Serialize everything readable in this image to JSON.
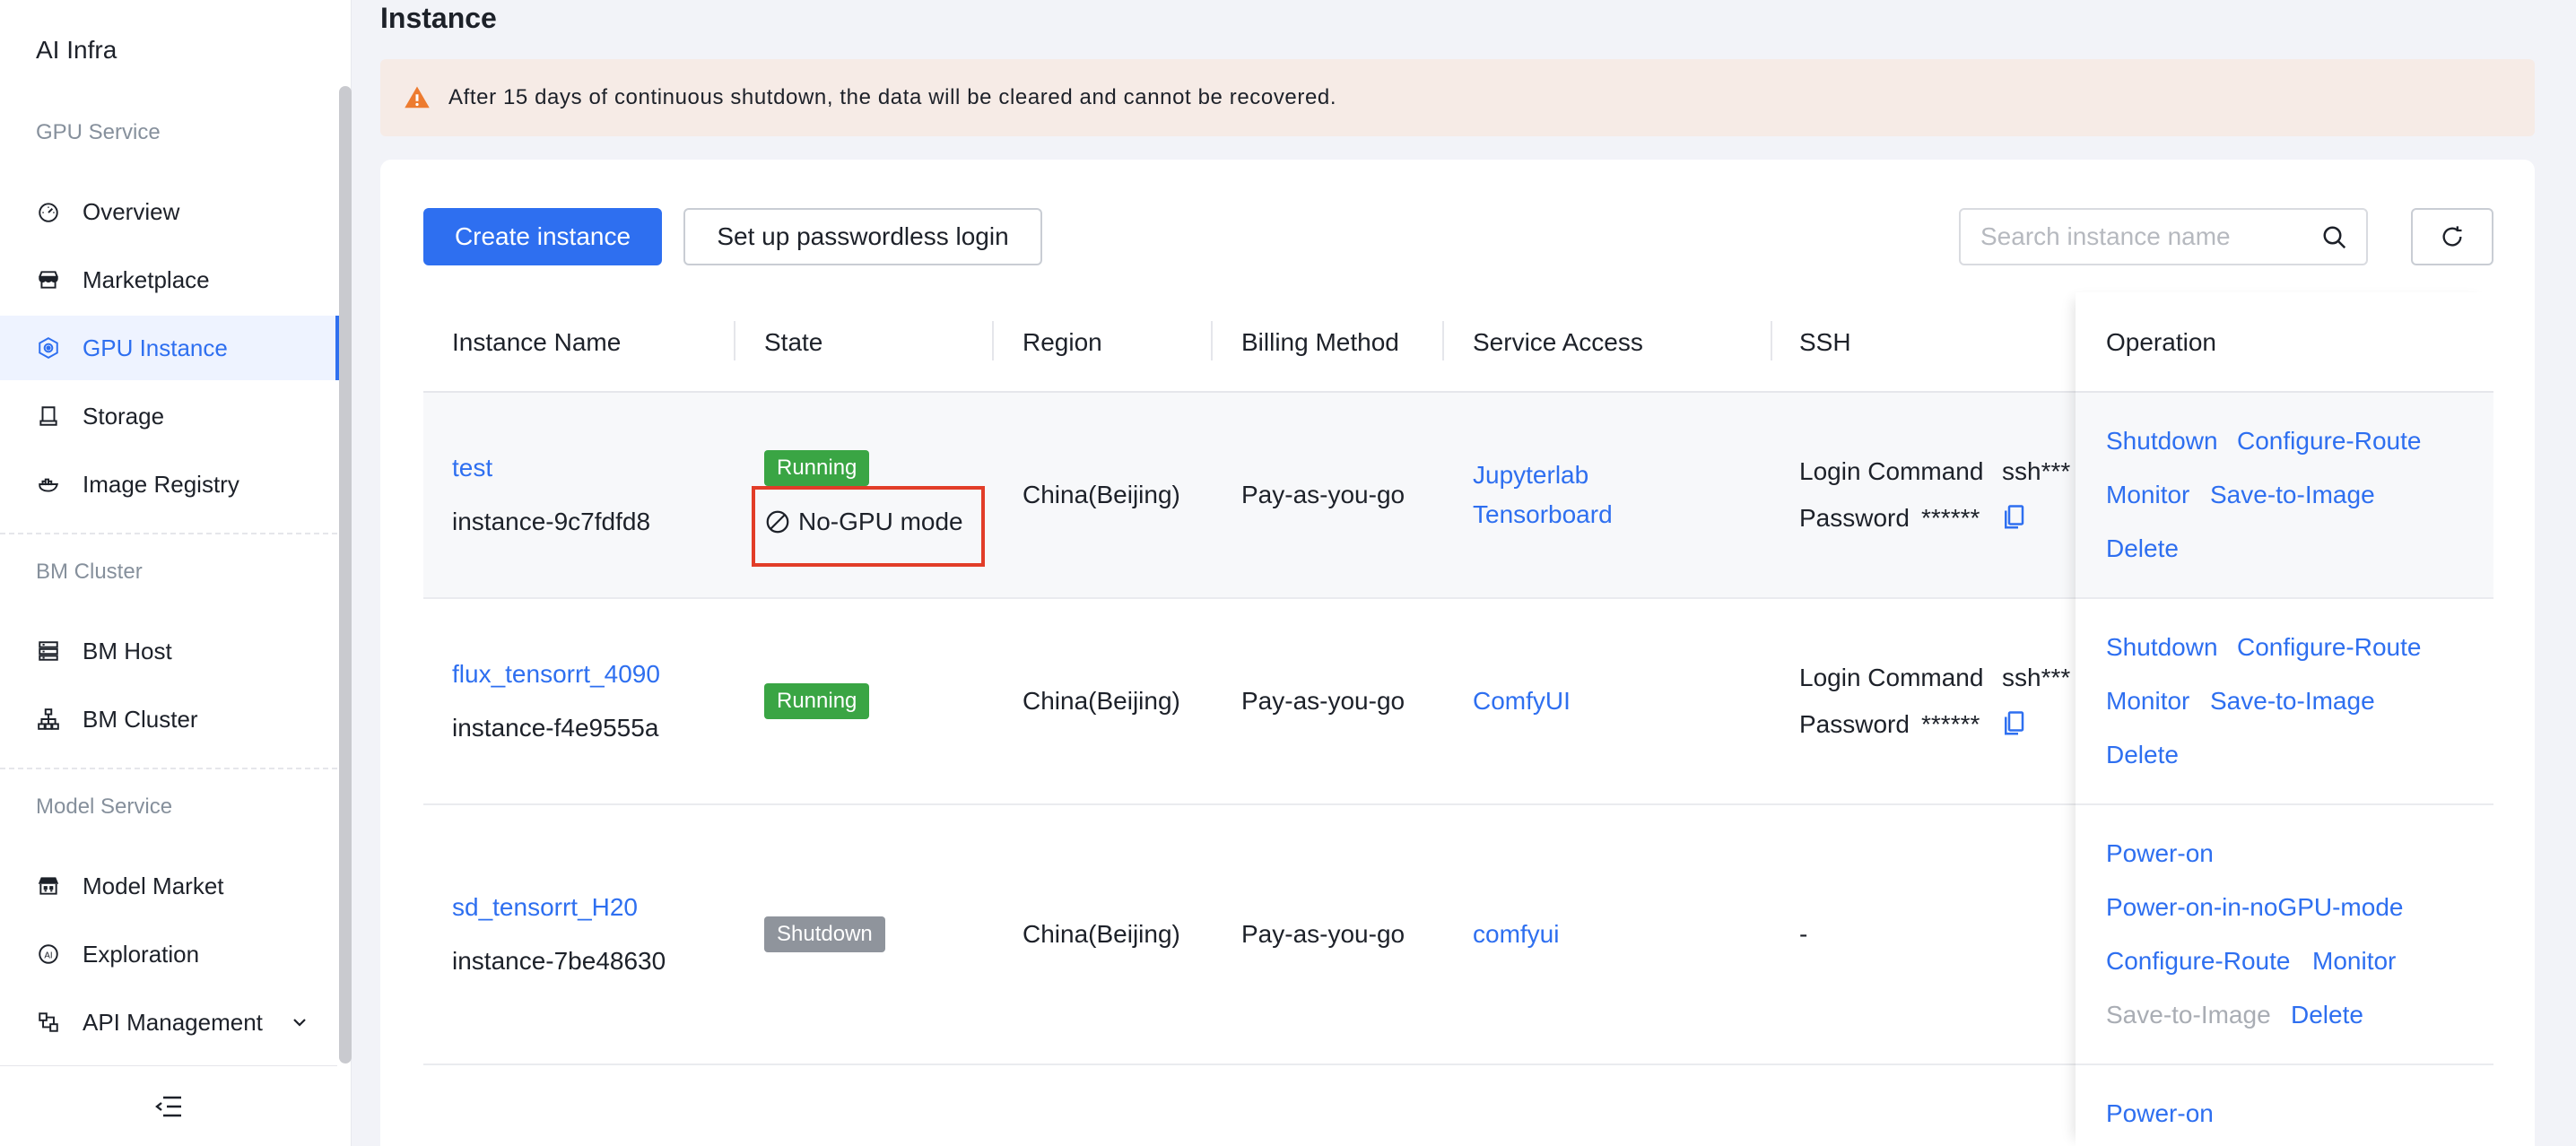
{
  "app": {
    "title": "AI Infra"
  },
  "sidebar": {
    "sections": [
      {
        "title": "GPU Service",
        "items": [
          {
            "label": "Overview",
            "icon": "dashboard-icon"
          },
          {
            "label": "Marketplace",
            "icon": "store-icon"
          },
          {
            "label": "GPU Instance",
            "icon": "chip-icon",
            "active": true
          },
          {
            "label": "Storage",
            "icon": "storage-icon"
          },
          {
            "label": "Image Registry",
            "icon": "container-icon"
          }
        ]
      },
      {
        "title": "BM Cluster",
        "items": [
          {
            "label": "BM Host",
            "icon": "server-icon"
          },
          {
            "label": "BM Cluster",
            "icon": "cluster-icon"
          }
        ]
      },
      {
        "title": "Model Service",
        "items": [
          {
            "label": "Model Market",
            "icon": "grid-store-icon"
          },
          {
            "label": "Exploration",
            "icon": "ai-icon"
          },
          {
            "label": "API Management",
            "icon": "api-icon"
          }
        ]
      }
    ]
  },
  "page": {
    "title": "Instance"
  },
  "alert": {
    "text": "After 15 days of continuous shutdown, the data will be cleared and cannot be recovered."
  },
  "toolbar": {
    "create_label": "Create instance",
    "passwordless_label": "Set up passwordless login",
    "search_placeholder": "Search instance name"
  },
  "table": {
    "columns": [
      "Instance Name",
      "State",
      "Region",
      "Billing Method",
      "Service Access",
      "SSH",
      "Operation"
    ],
    "ssh_login_label": "Login Command",
    "ssh_login_value": "ssh***",
    "ssh_password_label": "Password",
    "ssh_password_value": "******",
    "rows": [
      {
        "name": "test",
        "id": "instance-9c7fdfd8",
        "state": "Running",
        "mode": "No-GPU mode",
        "region": "China(Beijing)",
        "billing": "Pay-as-you-go",
        "access": [
          "Jupyterlab",
          "Tensorboard"
        ],
        "ops": [
          "Shutdown",
          "Configure-Route",
          "Monitor",
          "Save-to-Image",
          "Delete"
        ]
      },
      {
        "name": "flux_tensorrt_4090",
        "id": "instance-f4e9555a",
        "state": "Running",
        "region": "China(Beijing)",
        "billing": "Pay-as-you-go",
        "access": [
          "ComfyUI"
        ],
        "ops": [
          "Shutdown",
          "Configure-Route",
          "Monitor",
          "Save-to-Image",
          "Delete"
        ]
      },
      {
        "name": "sd_tensorrt_H20",
        "id": "instance-7be48630",
        "state": "Shutdown",
        "region": "China(Beijing)",
        "billing": "Pay-as-you-go",
        "access": [
          "comfyui"
        ],
        "ssh": "-",
        "ops": [
          "Power-on",
          "Power-on-in-noGPU-mode",
          "Configure-Route",
          "Monitor",
          "Save-to-Image",
          "Delete"
        ]
      },
      {
        "ops": [
          "Power-on"
        ]
      }
    ]
  },
  "colors": {
    "accent": "#2e6ff0",
    "running": "#3aa544",
    "shutdown": "#8f949c",
    "highlight": "#e23d28",
    "alert_bg": "#f6ebe6"
  }
}
